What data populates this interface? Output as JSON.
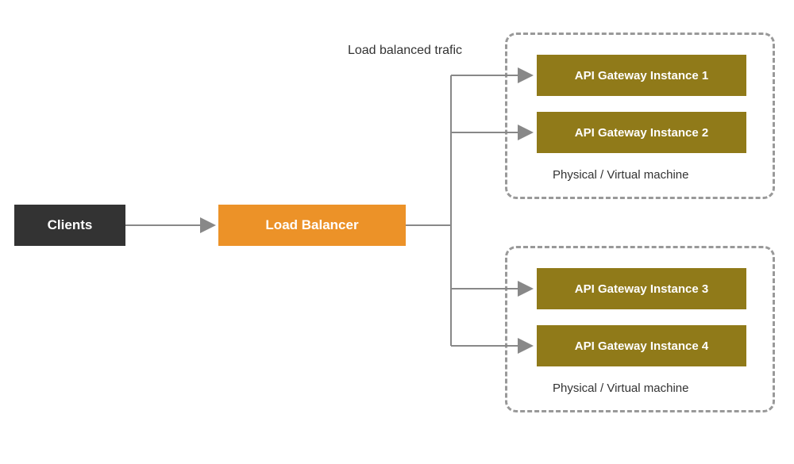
{
  "nodes": {
    "clients": "Clients",
    "load_balancer": "Load Balancer",
    "gateways": [
      "API Gateway Instance 1",
      "API Gateway Instance 2",
      "API Gateway Instance 3",
      "API Gateway Instance 4"
    ]
  },
  "labels": {
    "traffic": "Load balanced trafic",
    "machine": "Physical / Virtual machine"
  },
  "colors": {
    "clients_bg": "#333333",
    "lb_bg": "#ec9228",
    "gateway_bg": "#907a19",
    "arrow": "#888888",
    "container_border": "#999999"
  }
}
